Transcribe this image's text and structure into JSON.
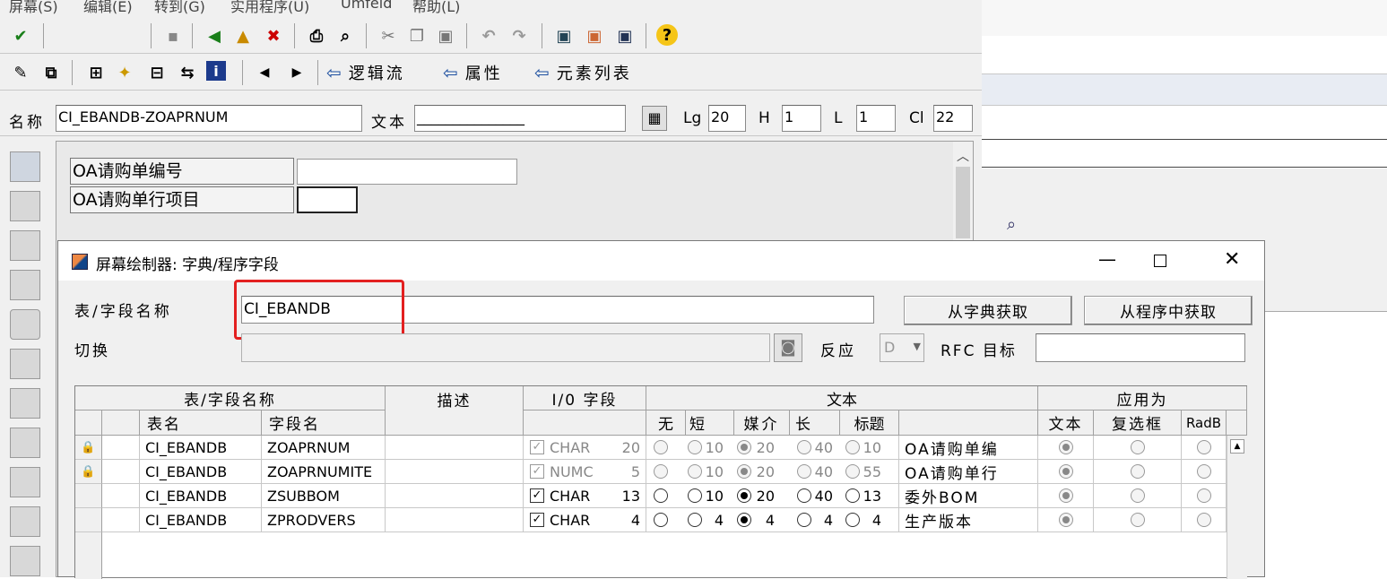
{
  "menu": [
    "屏幕(S)",
    "编辑(E)",
    "转到(G)",
    "实用程序(U)",
    "Umfeld",
    "帮助(L)"
  ],
  "toolbar2": {
    "flow_logic": "逻辑流",
    "attributes": "属性",
    "element_list": "元素列表"
  },
  "fieldbar": {
    "name_label": "名称",
    "name_value": "CI_EBANDB-ZOAPRNUM",
    "text_label": "文本",
    "text_value": "_______________",
    "lg_label": "Lg",
    "lg_value": "20",
    "h_label": "H",
    "h_value": "1",
    "l_label": "L",
    "l_value": "1",
    "cl_label": "Cl",
    "cl_value": "22"
  },
  "canvas": {
    "label1": "OA请购单编号",
    "label2": "OA请购单行项目"
  },
  "dialog": {
    "title": "屏幕绘制器: 字典/程序字段",
    "table_field_label": "表/字段名称",
    "table_field_value": "CI_EBANDB",
    "from_dict": "从字典获取",
    "from_program": "从程序中获取",
    "switch_label": "切换",
    "response_label": "反应",
    "response_value": "D",
    "rfc_label": "RFC 目标",
    "grid_headers": {
      "group_name": "表/字段名称",
      "desc": "描述",
      "io": "I/0 字段",
      "text": "文本",
      "apply": "应用为",
      "table": "表名",
      "field": "字段名",
      "none": "无",
      "short": "短",
      "medium": "媒介",
      "long": "长",
      "heading": "标题",
      "as_text": "文本",
      "as_check": "复选框",
      "as_radio": "RadB"
    },
    "rows": [
      {
        "table": "CI_EBANDB",
        "field": "ZOAPRNUM",
        "type": "CHAR",
        "len": "20",
        "s": "10",
        "m": "20",
        "l": "40",
        "h": "10",
        "text": "OA请购单编",
        "locked": true
      },
      {
        "table": "CI_EBANDB",
        "field": "ZOAPRNUMITE",
        "type": "NUMC",
        "len": "5",
        "s": "10",
        "m": "20",
        "l": "40",
        "h": "55",
        "text": "OA请购单行",
        "locked": true
      },
      {
        "table": "CI_EBANDB",
        "field": "ZSUBBOM",
        "type": "CHAR",
        "len": "13",
        "s": "10",
        "m": "20",
        "l": "40",
        "h": "13",
        "text": "委外BOM",
        "locked": false
      },
      {
        "table": "CI_EBANDB",
        "field": "ZPRODVERS",
        "type": "CHAR",
        "len": "4",
        "s": "4",
        "m": "4",
        "l": "4",
        "h": "4",
        "text": "生产版本",
        "locked": false
      }
    ]
  }
}
